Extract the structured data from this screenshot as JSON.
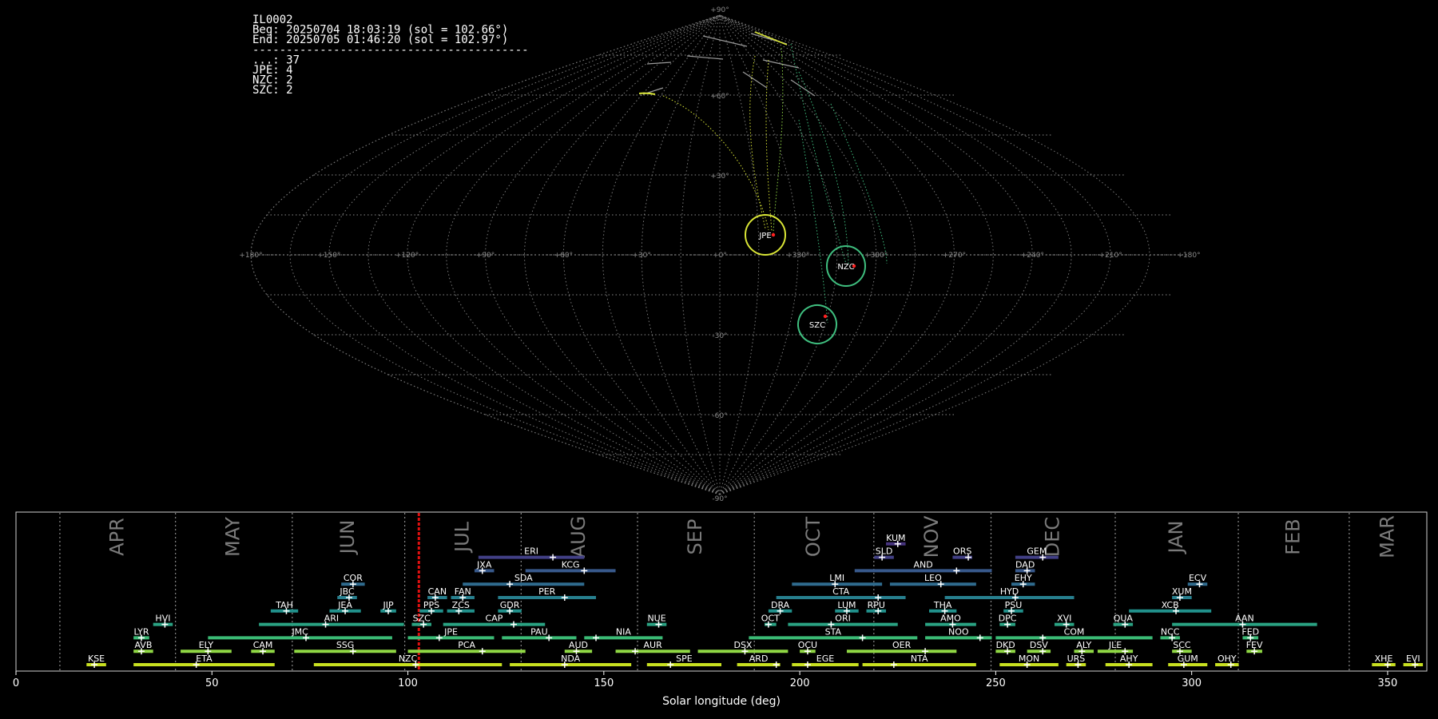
{
  "info": {
    "lines": [
      "IL0002",
      "Beg: 20250704 18:03:19 (sol = 102.66°)",
      "End: 20250705 01:46:20 (sol = 102.97°)",
      "-----------------------------------------",
      "...: 37",
      "JPE: 4",
      "NZC: 2",
      "SZC: 2"
    ]
  },
  "chart_data": [
    {
      "type": "scatter",
      "projection": "sinusoidal",
      "lat_labels": [
        "+90°",
        "+60°",
        "+30°",
        "-30°",
        "-60°",
        "-90°"
      ],
      "lon_labels": [
        "+180°",
        "+150°",
        "+120°",
        "+90°",
        "+60°",
        "+30°",
        "+0°",
        "+330°",
        "+300°",
        "+270°",
        "+240°",
        "+210°",
        "+180°"
      ],
      "radiants": [
        {
          "name": "JPE",
          "lon": 345,
          "lat": 5,
          "color": "#d9e536"
        },
        {
          "name": "NZC",
          "lon": 307,
          "lat": -3,
          "color": "#3fbf7f"
        },
        {
          "name": "SZC",
          "lon": 317,
          "lat": -20,
          "color": "#3fbf7f"
        }
      ],
      "grid": true
    },
    {
      "type": "bar",
      "xlabel": "Solar longitude (deg)",
      "xlim": [
        0,
        360
      ],
      "xticks": [
        0,
        50,
        100,
        150,
        200,
        250,
        300,
        350
      ],
      "current_sol": 102.8,
      "months": [
        {
          "name": "APR",
          "start": 11.2
        },
        {
          "name": "MAY",
          "start": 40.7
        },
        {
          "name": "JUN",
          "start": 70.5
        },
        {
          "name": "JUL",
          "start": 99.2
        },
        {
          "name": "AUG",
          "start": 128.9
        },
        {
          "name": "SEP",
          "start": 158.6
        },
        {
          "name": "OCT",
          "start": 188.4
        },
        {
          "name": "NOV",
          "start": 218.9
        },
        {
          "name": "DEC",
          "start": 248.8
        },
        {
          "name": "JAN",
          "start": 280.5
        },
        {
          "name": "FEB",
          "start": 311.9
        },
        {
          "name": "MAR",
          "start": 340.2
        }
      ],
      "showers": [
        {
          "code": "KUM",
          "start": 222,
          "end": 227,
          "peak": 225,
          "row": 9,
          "color": "#46337e"
        },
        {
          "code": "ERI",
          "start": 118,
          "end": 145,
          "peak": 137,
          "row": 8,
          "color": "#424086"
        },
        {
          "code": "SLD",
          "start": 219,
          "end": 224,
          "peak": 221,
          "row": 8,
          "color": "#424086"
        },
        {
          "code": "ORS",
          "start": 239,
          "end": 244,
          "peak": 243,
          "row": 8,
          "color": "#424086"
        },
        {
          "code": "GEM",
          "start": 255,
          "end": 266,
          "peak": 262,
          "row": 8,
          "color": "#424086"
        },
        {
          "code": "JXA",
          "start": 117,
          "end": 122,
          "peak": 119,
          "row": 7,
          "color": "#38598c"
        },
        {
          "code": "KCG",
          "start": 130,
          "end": 153,
          "peak": 145,
          "row": 7,
          "color": "#38598c"
        },
        {
          "code": "AND",
          "start": 214,
          "end": 249,
          "peak": 240,
          "row": 7,
          "color": "#38598c"
        },
        {
          "code": "DAD",
          "start": 255,
          "end": 260,
          "peak": 258,
          "row": 7,
          "color": "#38598c"
        },
        {
          "code": "COR",
          "start": 83,
          "end": 89,
          "peak": 86,
          "row": 6,
          "color": "#2f6b8e"
        },
        {
          "code": "SDA",
          "start": 114,
          "end": 145,
          "peak": 126,
          "row": 6,
          "color": "#2f6b8e"
        },
        {
          "code": "LMI",
          "start": 198,
          "end": 221,
          "peak": 209,
          "row": 6,
          "color": "#2f6b8e"
        },
        {
          "code": "LEO",
          "start": 223,
          "end": 245,
          "peak": 236,
          "row": 6,
          "color": "#2f6b8e"
        },
        {
          "code": "EHY",
          "start": 254,
          "end": 260,
          "peak": 257,
          "row": 6,
          "color": "#2f6b8e"
        },
        {
          "code": "ECV",
          "start": 299,
          "end": 304,
          "peak": 302,
          "row": 6,
          "color": "#2f6b8e"
        },
        {
          "code": "JBC",
          "start": 82,
          "end": 87,
          "peak": 85,
          "row": 5,
          "color": "#277f8e"
        },
        {
          "code": "CAN",
          "start": 105,
          "end": 110,
          "peak": 107,
          "row": 5,
          "color": "#277f8e"
        },
        {
          "code": "FAN",
          "start": 111,
          "end": 117,
          "peak": 114,
          "row": 5,
          "color": "#277f8e"
        },
        {
          "code": "PER",
          "start": 123,
          "end": 148,
          "peak": 140,
          "row": 5,
          "color": "#277f8e"
        },
        {
          "code": "CTA",
          "start": 194,
          "end": 227,
          "peak": 220,
          "row": 5,
          "color": "#277f8e"
        },
        {
          "code": "HYD",
          "start": 237,
          "end": 270,
          "peak": 255,
          "row": 5,
          "color": "#277f8e"
        },
        {
          "code": "XUM",
          "start": 295,
          "end": 300,
          "peak": 297,
          "row": 5,
          "color": "#277f8e"
        },
        {
          "code": "TAH",
          "start": 65,
          "end": 72,
          "peak": 69,
          "row": 4,
          "color": "#21918c"
        },
        {
          "code": "JEA",
          "start": 80,
          "end": 88,
          "peak": 84,
          "row": 4,
          "color": "#21918c"
        },
        {
          "code": "JIP",
          "start": 93,
          "end": 97,
          "peak": 95,
          "row": 4,
          "color": "#21918c"
        },
        {
          "code": "PPS",
          "start": 103,
          "end": 109,
          "peak": 106,
          "row": 4,
          "color": "#21918c"
        },
        {
          "code": "ZCS",
          "start": 110,
          "end": 117,
          "peak": 113,
          "row": 4,
          "color": "#21918c"
        },
        {
          "code": "GDR",
          "start": 123,
          "end": 129,
          "peak": 126,
          "row": 4,
          "color": "#21918c"
        },
        {
          "code": "DRA",
          "start": 192,
          "end": 198,
          "peak": 195,
          "row": 4,
          "color": "#21918c"
        },
        {
          "code": "LUM",
          "start": 209,
          "end": 215,
          "peak": 212,
          "row": 4,
          "color": "#21918c"
        },
        {
          "code": "RPU",
          "start": 217,
          "end": 222,
          "peak": 220,
          "row": 4,
          "color": "#21918c"
        },
        {
          "code": "THA",
          "start": 233,
          "end": 240,
          "peak": 237,
          "row": 4,
          "color": "#21918c"
        },
        {
          "code": "PSU",
          "start": 252,
          "end": 257,
          "peak": 254,
          "row": 4,
          "color": "#21918c"
        },
        {
          "code": "XCB",
          "start": 284,
          "end": 305,
          "peak": 296,
          "row": 4,
          "color": "#21918c"
        },
        {
          "code": "HVI",
          "start": 35,
          "end": 40,
          "peak": 38,
          "row": 3,
          "color": "#2aa383"
        },
        {
          "code": "ARI",
          "start": 62,
          "end": 99,
          "peak": 79,
          "row": 3,
          "color": "#2aa383"
        },
        {
          "code": "SZC",
          "start": 101,
          "end": 106,
          "peak": 104,
          "row": 3,
          "color": "#2aa383"
        },
        {
          "code": "CAP",
          "start": 109,
          "end": 135,
          "peak": 127,
          "row": 3,
          "color": "#2aa383"
        },
        {
          "code": "NUE",
          "start": 161,
          "end": 166,
          "peak": 164,
          "row": 3,
          "color": "#2aa383"
        },
        {
          "code": "OCT",
          "start": 191,
          "end": 194,
          "peak": 192,
          "row": 3,
          "color": "#2aa383"
        },
        {
          "code": "ORI",
          "start": 197,
          "end": 225,
          "peak": 208,
          "row": 3,
          "color": "#2aa383"
        },
        {
          "code": "AMO",
          "start": 232,
          "end": 245,
          "peak": 239,
          "row": 3,
          "color": "#2aa383"
        },
        {
          "code": "DPC",
          "start": 251,
          "end": 255,
          "peak": 253,
          "row": 3,
          "color": "#2aa383"
        },
        {
          "code": "XVI",
          "start": 265,
          "end": 270,
          "peak": 268,
          "row": 3,
          "color": "#2aa383"
        },
        {
          "code": "QUA",
          "start": 280,
          "end": 285,
          "peak": 283,
          "row": 3,
          "color": "#2aa383"
        },
        {
          "code": "AAN",
          "start": 295,
          "end": 332,
          "peak": 313,
          "row": 3,
          "color": "#2aa383"
        },
        {
          "code": "LYR",
          "start": 30,
          "end": 34,
          "peak": 32,
          "row": 2,
          "color": "#3bba75"
        },
        {
          "code": "JMC",
          "start": 49,
          "end": 96,
          "peak": 74,
          "row": 2,
          "color": "#3bba75"
        },
        {
          "code": "JPE",
          "start": 100,
          "end": 122,
          "peak": 108,
          "row": 2,
          "color": "#3bba75"
        },
        {
          "code": "PAU",
          "start": 124,
          "end": 143,
          "peak": 136,
          "row": 2,
          "color": "#3bba75"
        },
        {
          "code": "NIA",
          "start": 145,
          "end": 165,
          "peak": 148,
          "row": 2,
          "color": "#3bba75"
        },
        {
          "code": "STA",
          "start": 187,
          "end": 230,
          "peak": 216,
          "row": 2,
          "color": "#3bba75"
        },
        {
          "code": "NOO",
          "start": 232,
          "end": 249,
          "peak": 246,
          "row": 2,
          "color": "#3bba75"
        },
        {
          "code": "COM",
          "start": 250,
          "end": 290,
          "peak": 262,
          "row": 2,
          "color": "#3bba75"
        },
        {
          "code": "NCC",
          "start": 292,
          "end": 297,
          "peak": 295,
          "row": 2,
          "color": "#3bba75"
        },
        {
          "code": "FED",
          "start": 313,
          "end": 317,
          "peak": 315,
          "row": 2,
          "color": "#3bba75"
        },
        {
          "code": "AVB",
          "start": 30,
          "end": 35,
          "peak": 32,
          "row": 1,
          "color": "#8fd744"
        },
        {
          "code": "ELY",
          "start": 42,
          "end": 55,
          "peak": 49,
          "row": 1,
          "color": "#8fd744"
        },
        {
          "code": "CAM",
          "start": 60,
          "end": 66,
          "peak": 63,
          "row": 1,
          "color": "#8fd744"
        },
        {
          "code": "SSG",
          "start": 71,
          "end": 97,
          "peak": 86,
          "row": 1,
          "color": "#8fd744"
        },
        {
          "code": "PCA",
          "start": 100,
          "end": 130,
          "peak": 119,
          "row": 1,
          "color": "#8fd744"
        },
        {
          "code": "AUD",
          "start": 140,
          "end": 147,
          "peak": 143,
          "row": 1,
          "color": "#8fd744"
        },
        {
          "code": "AUR",
          "start": 153,
          "end": 172,
          "peak": 158,
          "row": 1,
          "color": "#8fd744"
        },
        {
          "code": "DSX",
          "start": 174,
          "end": 197,
          "peak": 186,
          "row": 1,
          "color": "#8fd744"
        },
        {
          "code": "OCU",
          "start": 200,
          "end": 204,
          "peak": 202,
          "row": 1,
          "color": "#8fd744"
        },
        {
          "code": "OER",
          "start": 212,
          "end": 240,
          "peak": 232,
          "row": 1,
          "color": "#8fd744"
        },
        {
          "code": "DKD",
          "start": 250,
          "end": 255,
          "peak": 253,
          "row": 1,
          "color": "#8fd744"
        },
        {
          "code": "DSV",
          "start": 258,
          "end": 264,
          "peak": 262,
          "row": 1,
          "color": "#8fd744"
        },
        {
          "code": "ALY",
          "start": 270,
          "end": 275,
          "peak": 272,
          "row": 1,
          "color": "#8fd744"
        },
        {
          "code": "JLE",
          "start": 276,
          "end": 285,
          "peak": 283,
          "row": 1,
          "color": "#8fd744"
        },
        {
          "code": "SCC",
          "start": 295,
          "end": 300,
          "peak": 297,
          "row": 1,
          "color": "#8fd744"
        },
        {
          "code": "FEV",
          "start": 314,
          "end": 318,
          "peak": 316,
          "row": 1,
          "color": "#8fd744"
        },
        {
          "code": "KSE",
          "start": 18,
          "end": 23,
          "peak": 20,
          "row": 0,
          "color": "#c8e020"
        },
        {
          "code": "ETA",
          "start": 30,
          "end": 66,
          "peak": 46,
          "row": 0,
          "color": "#c8e020"
        },
        {
          "code": "NZC",
          "start": 76,
          "end": 124,
          "peak": 102,
          "row": 0,
          "color": "#c8e020"
        },
        {
          "code": "NDA",
          "start": 126,
          "end": 157,
          "peak": 140,
          "row": 0,
          "color": "#c8e020"
        },
        {
          "code": "SPE",
          "start": 161,
          "end": 180,
          "peak": 167,
          "row": 0,
          "color": "#c8e020"
        },
        {
          "code": "ARD",
          "start": 184,
          "end": 195,
          "peak": 194,
          "row": 0,
          "color": "#c8e020"
        },
        {
          "code": "EGE",
          "start": 198,
          "end": 215,
          "peak": 202,
          "row": 0,
          "color": "#c8e020"
        },
        {
          "code": "NTA",
          "start": 216,
          "end": 245,
          "peak": 224,
          "row": 0,
          "color": "#c8e020"
        },
        {
          "code": "MON",
          "start": 251,
          "end": 266,
          "peak": 258,
          "row": 0,
          "color": "#c8e020"
        },
        {
          "code": "URS",
          "start": 268,
          "end": 273,
          "peak": 271,
          "row": 0,
          "color": "#c8e020"
        },
        {
          "code": "AHY",
          "start": 278,
          "end": 290,
          "peak": 284,
          "row": 0,
          "color": "#c8e020"
        },
        {
          "code": "GUM",
          "start": 294,
          "end": 304,
          "peak": 298,
          "row": 0,
          "color": "#c8e020"
        },
        {
          "code": "OHY",
          "start": 306,
          "end": 312,
          "peak": 310,
          "row": 0,
          "color": "#c8e020"
        },
        {
          "code": "XHE",
          "start": 346,
          "end": 352,
          "peak": 350,
          "row": 0,
          "color": "#c8e020"
        },
        {
          "code": "EVI",
          "start": 354,
          "end": 359,
          "peak": 357,
          "row": 0,
          "color": "#c8e020"
        }
      ]
    }
  ]
}
